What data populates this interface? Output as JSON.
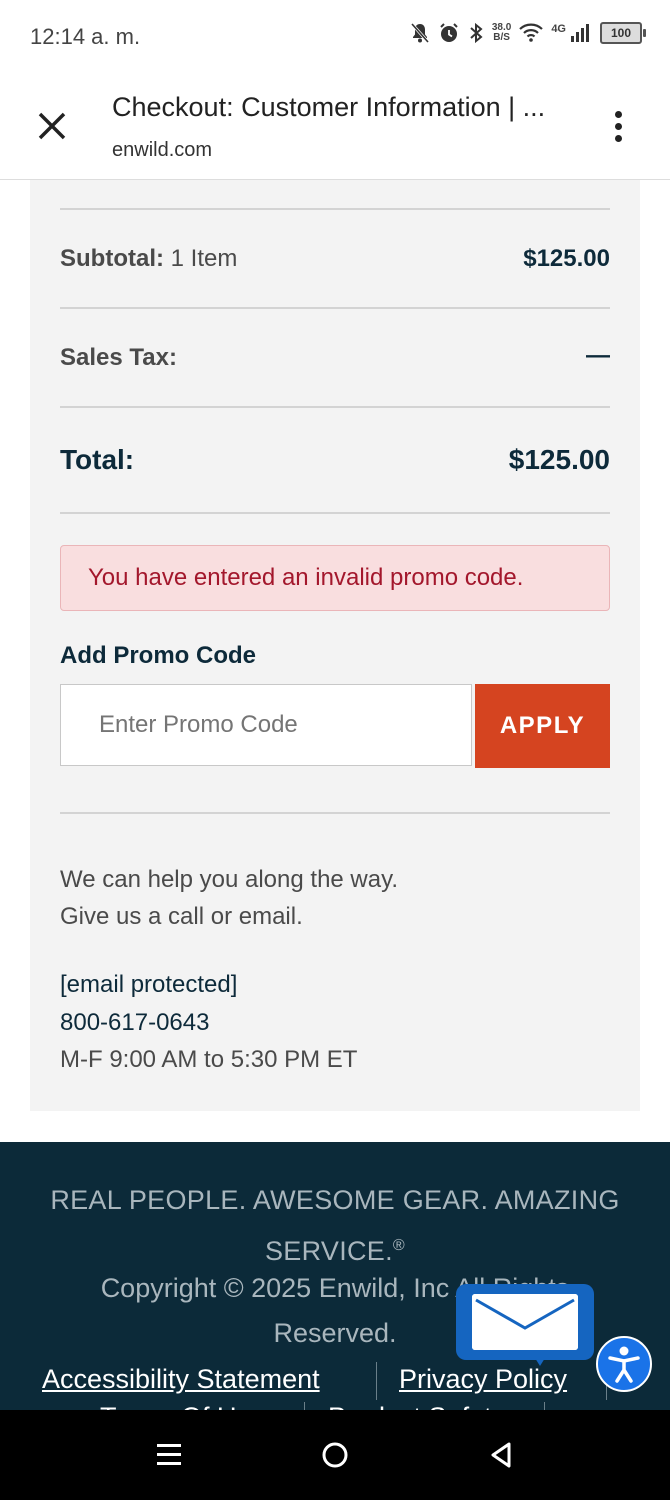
{
  "status_bar": {
    "time": "12:14 a. m.",
    "net_speed_value": "38.0",
    "net_speed_unit": "B/S",
    "network": "4G",
    "battery": "100"
  },
  "browser": {
    "title": "Checkout: Customer Information | ...",
    "domain": "enwild.com"
  },
  "summary": {
    "subtotal_label": "Subtotal:",
    "subtotal_items": "1 Item",
    "subtotal_value": "$125.00",
    "tax_label": "Sales Tax:",
    "tax_value": "—",
    "total_label": "Total:",
    "total_value": "$125.00"
  },
  "promo": {
    "error": "You have entered an invalid promo code.",
    "label": "Add Promo Code",
    "placeholder": "Enter Promo Code",
    "value": "",
    "apply_label": "APPLY"
  },
  "help": {
    "line1": "We can help you along the way.",
    "line2": "Give us a call or email.",
    "email": "[email protected]",
    "phone": "800-617-0643",
    "hours": "M-F 9:00 AM to 5:30 PM ET"
  },
  "footer": {
    "tagline_line1": "REAL PEOPLE. AWESOME GEAR. AMAZING",
    "tagline_line2": "SERVICE.",
    "tagline_mark": "®",
    "copyright_line1": "Copyright © 2025 Enwild, Inc All Rights",
    "copyright_line2": "Reserved.",
    "links": [
      "Accessibility Statement",
      "Privacy Policy"
    ],
    "links_row2": [
      "Terms Of Use",
      "Product Safety"
    ]
  },
  "colors": {
    "accent": "#d54420",
    "footer_bg": "#0c2a39",
    "error_bg": "#f9dedf",
    "error_text": "#a3172c",
    "chat_blue": "#1565c0"
  },
  "icons": {
    "close": "close-icon",
    "menu": "more-vert-icon",
    "chat": "mail-icon",
    "accessibility": "accessibility-icon"
  }
}
